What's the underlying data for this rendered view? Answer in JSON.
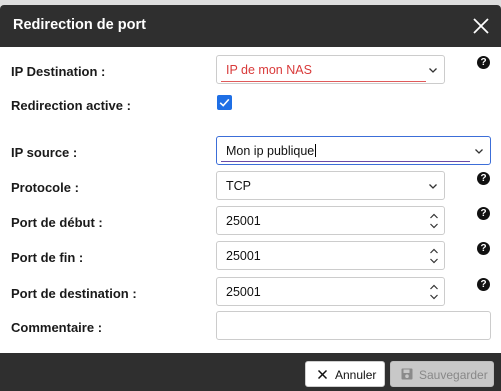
{
  "dialog": {
    "title": "Redirection de port",
    "close_icon": "close-icon"
  },
  "form": {
    "ip_destination": {
      "label": "IP Destination :",
      "value": "IP de mon NAS"
    },
    "redirection_active": {
      "label": "Redirection active :",
      "checked": true
    },
    "ip_source": {
      "label": "IP source :",
      "value": "Mon ip publique"
    },
    "protocole": {
      "label": "Protocole :",
      "value": "TCP"
    },
    "port_debut": {
      "label": "Port de début :",
      "value": "25001"
    },
    "port_fin": {
      "label": "Port de fin :",
      "value": "25001"
    },
    "port_destination": {
      "label": "Port de destination :",
      "value": "25001"
    },
    "commentaire": {
      "label": "Commentaire :",
      "value": ""
    },
    "help_glyph": "?"
  },
  "footer": {
    "cancel_label": "Annuler",
    "save_label": "Sauvegarder"
  },
  "colors": {
    "titlebar": "#2f2f2f",
    "accent_blue": "#1f6fe5",
    "error_red": "#d93a3a"
  }
}
